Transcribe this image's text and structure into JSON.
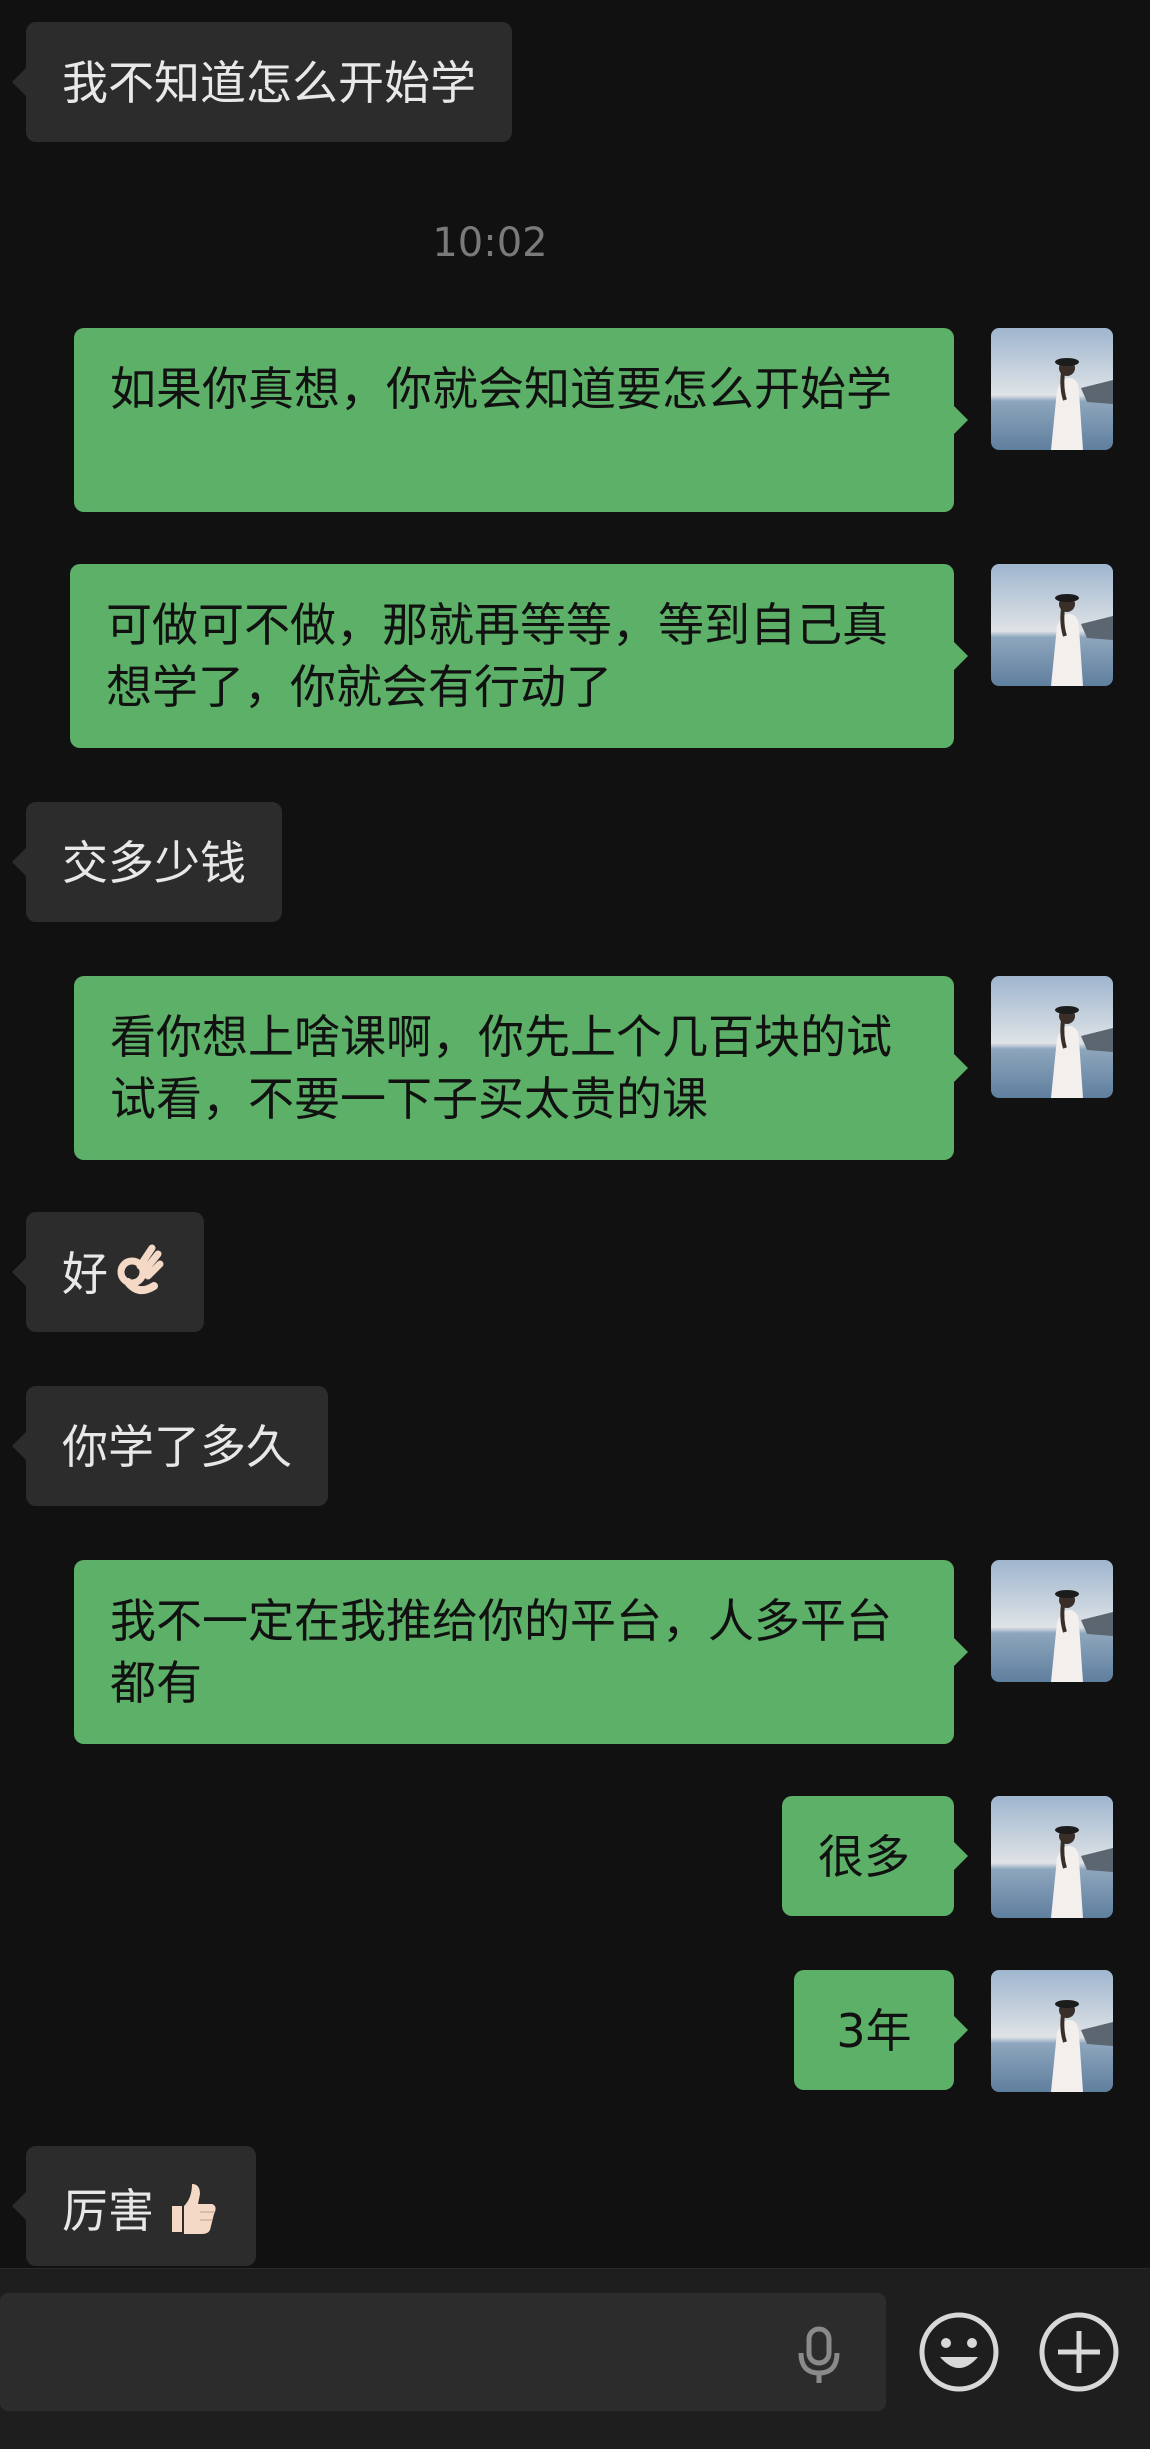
{
  "conversation": {
    "timestamp": "10:02",
    "messages": [
      {
        "side": "in",
        "text": "我不知道怎么开始学"
      },
      {
        "side": "out",
        "text": "如果你真想，你就会知道要怎么开始学"
      },
      {
        "side": "out",
        "text": "可做可不做，那就再等等，等到自己真想学了，你就会有行动了"
      },
      {
        "side": "in",
        "text": "交多少钱"
      },
      {
        "side": "out",
        "text": "看你想上啥课啊，你先上个几百块的试试看，不要一下子买太贵的课"
      },
      {
        "side": "in",
        "text": "好",
        "emoji": "ok-hand-emoji"
      },
      {
        "side": "in",
        "text": "你学了多久"
      },
      {
        "side": "out",
        "text": "我不一定在我推给你的平台，人多平台都有"
      },
      {
        "side": "out",
        "text": "很多"
      },
      {
        "side": "out",
        "text": "3年"
      },
      {
        "side": "in",
        "text": "厉害",
        "emoji": "thumbs-up-emoji"
      }
    ]
  },
  "input_bar": {
    "icons": [
      "microphone-icon",
      "emoji-face-icon",
      "add-plus-icon"
    ]
  },
  "colors": {
    "background": "#111111",
    "incoming_bubble": "#2c2c2c",
    "outgoing_bubble": "#5cb067",
    "timestamp": "#7a7a7a"
  }
}
